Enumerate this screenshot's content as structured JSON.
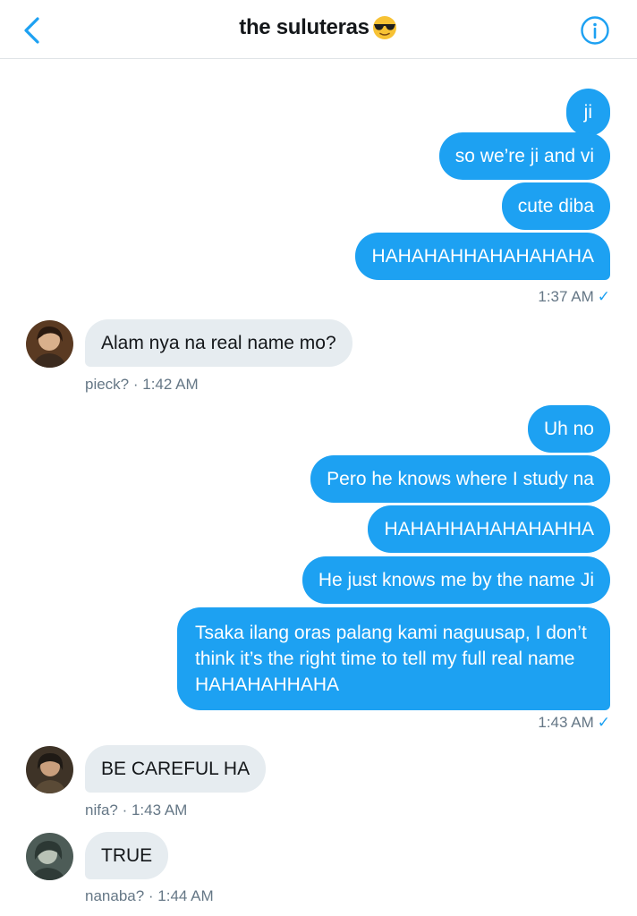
{
  "header": {
    "title": "the suluteras",
    "emoji": "sunglasses-emoji"
  },
  "messages_group1": {
    "m1": "ji",
    "m2": "so we’re ji and vi",
    "m3": "cute diba",
    "m4": "HAHAHAHHAHAHAHAHA",
    "time": "1:37 AM",
    "status": "✓"
  },
  "incoming1": {
    "text": "Alam nya na real name mo?",
    "meta": "pieck? · 1:42 AM"
  },
  "messages_group2": {
    "m1": "Uh no",
    "m2": "Pero he knows where I study na",
    "m3": "HAHAHHAHAHAHAHHA",
    "m4": "He just knows me by the name Ji",
    "m5": "Tsaka ilang oras palang kami naguusap, I don’t think it’s the right time to tell my full real name HAHAHAHHAHA",
    "time": "1:43 AM",
    "status": "✓"
  },
  "incoming2": {
    "text": "BE CAREFUL HA",
    "meta": "nifa? · 1:43 AM"
  },
  "incoming3": {
    "text": "TRUE",
    "meta": "nanaba? · 1:44 AM"
  },
  "colors": {
    "accent": "#1da1f2",
    "incoming_bubble": "#e6ecf0",
    "meta_text": "#657786"
  }
}
